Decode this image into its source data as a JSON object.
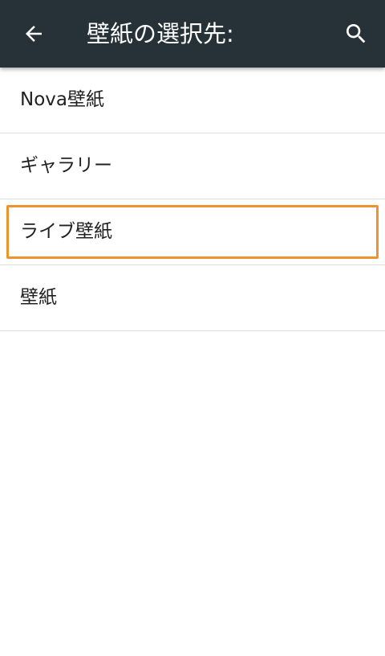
{
  "header": {
    "title": "壁紙の選択先:",
    "back_icon": "arrow-back-icon",
    "search_icon": "search-icon"
  },
  "list": {
    "items": [
      {
        "label": "Nova壁紙",
        "selected": false
      },
      {
        "label": "ギャラリー",
        "selected": false
      },
      {
        "label": "ライブ壁紙",
        "selected": true
      },
      {
        "label": "壁紙",
        "selected": false
      }
    ]
  },
  "colors": {
    "app_bar": "#263238",
    "focus": "#f0922e"
  }
}
